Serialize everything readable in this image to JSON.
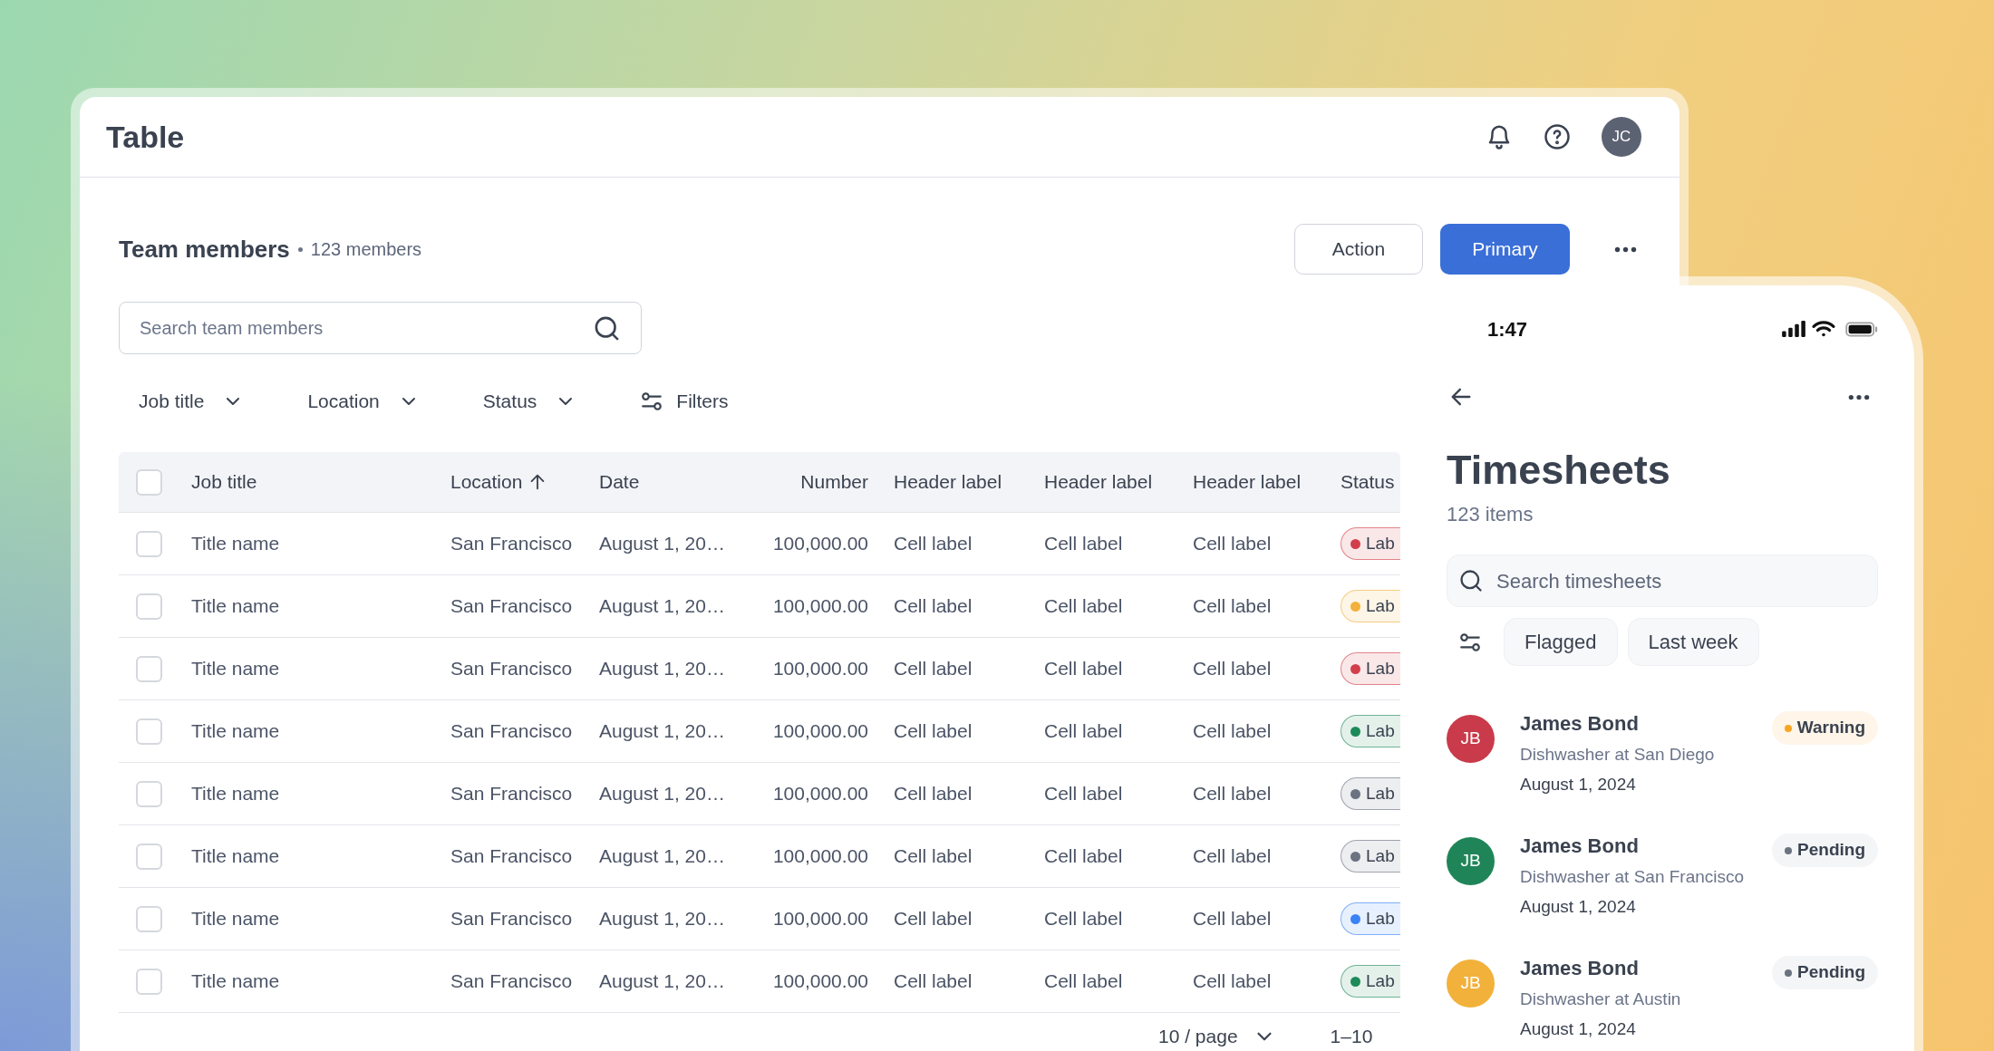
{
  "app": {
    "title": "Table",
    "avatar": "JC"
  },
  "section": {
    "title": "Team members",
    "count": "123 members"
  },
  "buttons": [
    {
      "label": "Action",
      "kind": "secondary"
    },
    {
      "label": "Primary",
      "kind": "primary"
    }
  ],
  "search": {
    "placeholder": "Search team members"
  },
  "filters": [
    {
      "label": "Job title",
      "kind": "dropdown"
    },
    {
      "label": "Location",
      "kind": "dropdown"
    },
    {
      "label": "Status",
      "kind": "dropdown"
    },
    {
      "label": "Filters",
      "kind": "more"
    }
  ],
  "table": {
    "header_checked": false,
    "columns": [
      {
        "label": "Job title",
        "sorted": false
      },
      {
        "label": "Location",
        "sorted": true
      },
      {
        "label": "Date",
        "sorted": false
      },
      {
        "label": "Number",
        "sorted": false
      },
      {
        "label": "Header label",
        "sorted": false
      },
      {
        "label": "Header label",
        "sorted": false
      },
      {
        "label": "Header label",
        "sorted": false
      },
      {
        "label": "Status",
        "sorted": false
      }
    ],
    "rows": [
      {
        "checked": false,
        "cells": [
          "Title name",
          "San Francisco",
          "August 1, 20…",
          "100,000.00",
          "Cell label",
          "Cell label",
          "Cell label"
        ],
        "status": {
          "label": "Lab",
          "color": "#d23f4b"
        }
      },
      {
        "checked": false,
        "cells": [
          "Title name",
          "San Francisco",
          "August 1, 20…",
          "100,000.00",
          "Cell label",
          "Cell label",
          "Cell label"
        ],
        "status": {
          "label": "Lab",
          "color": "#f2b13b"
        }
      },
      {
        "checked": false,
        "cells": [
          "Title name",
          "San Francisco",
          "August 1, 20…",
          "100,000.00",
          "Cell label",
          "Cell label",
          "Cell label"
        ],
        "status": {
          "label": "Lab",
          "color": "#d23f4b"
        }
      },
      {
        "checked": false,
        "cells": [
          "Title name",
          "San Francisco",
          "August 1, 20…",
          "100,000.00",
          "Cell label",
          "Cell label",
          "Cell label"
        ],
        "status": {
          "label": "Lab",
          "color": "#1e8a5a"
        }
      },
      {
        "checked": false,
        "cells": [
          "Title name",
          "San Francisco",
          "August 1, 20…",
          "100,000.00",
          "Cell label",
          "Cell label",
          "Cell label"
        ],
        "status": {
          "label": "Lab",
          "color": "#6b7280"
        }
      },
      {
        "checked": false,
        "cells": [
          "Title name",
          "San Francisco",
          "August 1, 20…",
          "100,000.00",
          "Cell label",
          "Cell label",
          "Cell label"
        ],
        "status": {
          "label": "Lab",
          "color": "#6b7280"
        }
      },
      {
        "checked": false,
        "cells": [
          "Title name",
          "San Francisco",
          "August 1, 20…",
          "100,000.00",
          "Cell label",
          "Cell label",
          "Cell label"
        ],
        "status": {
          "label": "Lab",
          "color": "#3b82f6"
        }
      },
      {
        "checked": false,
        "cells": [
          "Title name",
          "San Francisco",
          "August 1, 20…",
          "100,000.00",
          "Cell label",
          "Cell label",
          "Cell label"
        ],
        "status": {
          "label": "Lab",
          "color": "#1e8a5a"
        }
      }
    ]
  },
  "pagination": {
    "page_size": "10 / page",
    "range": "1–10"
  },
  "phone": {
    "time": "1:47",
    "title": "Timesheets",
    "count": "123 items",
    "search_placeholder": "Search timesheets",
    "chips": [
      {
        "label": "Flagged",
        "selected": false
      },
      {
        "label": "Last week",
        "selected": false
      }
    ],
    "entries": [
      {
        "initials": "JB",
        "color": "#c93a4a",
        "name": "James Bond",
        "subtitle": "Dishwasher at San Diego",
        "date": "August 1, 2024",
        "status": {
          "label": "Warning",
          "kind": "warning"
        }
      },
      {
        "initials": "JB",
        "color": "#1f8559",
        "name": "James Bond",
        "subtitle": "Dishwasher at San Francisco",
        "date": "August 1, 2024",
        "status": {
          "label": "Pending",
          "kind": "pending"
        }
      },
      {
        "initials": "JB",
        "color": "#f2b13b",
        "name": "James Bond",
        "subtitle": "Dishwasher at Austin",
        "date": "August 1, 2024",
        "status": {
          "label": "Pending",
          "kind": "pending"
        }
      }
    ]
  }
}
